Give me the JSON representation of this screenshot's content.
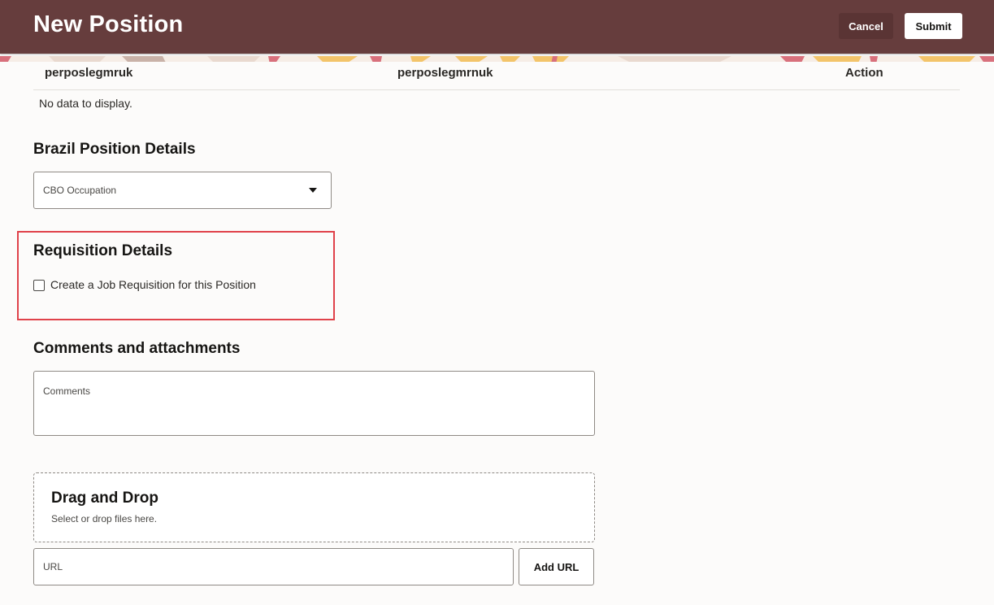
{
  "header": {
    "title": "New Position",
    "cancel_label": "Cancel",
    "submit_label": "Submit"
  },
  "table": {
    "columns": [
      "perposlegmruk",
      "perposlegmrnuk",
      "Action"
    ],
    "empty_message": "No data to display."
  },
  "brazil": {
    "title": "Brazil Position Details",
    "cbo_label": "CBO Occupation"
  },
  "requisition": {
    "title": "Requisition Details",
    "checkbox_label": "Create a Job Requisition for this Position",
    "checked": false
  },
  "comments": {
    "title": "Comments and attachments",
    "comments_label": "Comments",
    "drop_title": "Drag and Drop",
    "drop_subtitle": "Select or drop files here.",
    "url_label": "URL",
    "add_url_label": "Add URL"
  },
  "colors": {
    "header_bg": "#663d3d",
    "highlight": "#e0424a",
    "pattern_yellow": "#f3c46a",
    "pattern_pink": "#d8707c"
  }
}
